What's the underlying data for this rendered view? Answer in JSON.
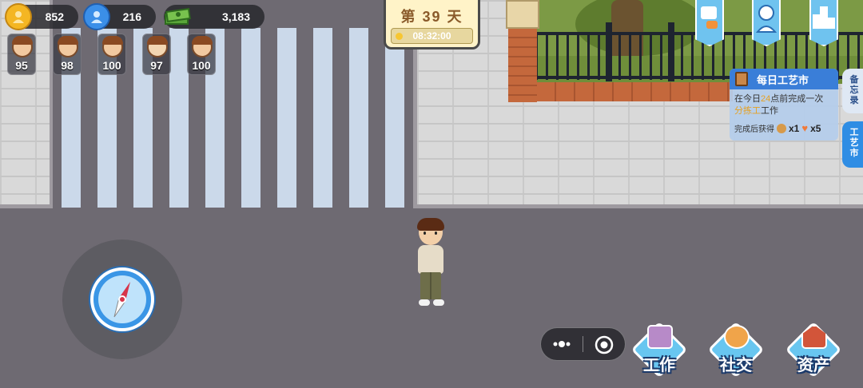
{
  "resources": {
    "coins": {
      "icon": "gold-coin-icon",
      "value": "852"
    },
    "people": {
      "icon": "person-icon",
      "value": "216"
    },
    "cash": {
      "icon": "cash-stack-icon",
      "value": "3,183"
    }
  },
  "stats": [
    {
      "icon": "character-hungry-icon",
      "value": "95"
    },
    {
      "icon": "character-tired-icon",
      "value": "98"
    },
    {
      "icon": "character-health-icon",
      "value": "100"
    },
    {
      "icon": "character-mood-icon",
      "value": "97"
    },
    {
      "icon": "character-energy-icon",
      "value": "100"
    }
  ],
  "day_panel": {
    "title": "第 39 天",
    "time": "08:32:00"
  },
  "top_icons": [
    "chat-bubble-icon",
    "profile-icon",
    "ranking-icon"
  ],
  "quest": {
    "title": "每日工艺市",
    "line1_pre": "在今日",
    "line1_hl": "24",
    "line1_post": "点前完成一次",
    "line2_hl": "分拣工",
    "line2_post": "工作",
    "reward_label": "完成后获得",
    "reward1": "x1",
    "reward2": "x5"
  },
  "side_tabs": {
    "memo": "备忘录",
    "craft": "工艺市"
  },
  "actions": {
    "work": "工作",
    "social": "社交",
    "assets": "资产"
  },
  "colors": {
    "road": "#6e6a72",
    "button_blue": "#68c6f0",
    "quest_header": "#3a7ed8"
  }
}
